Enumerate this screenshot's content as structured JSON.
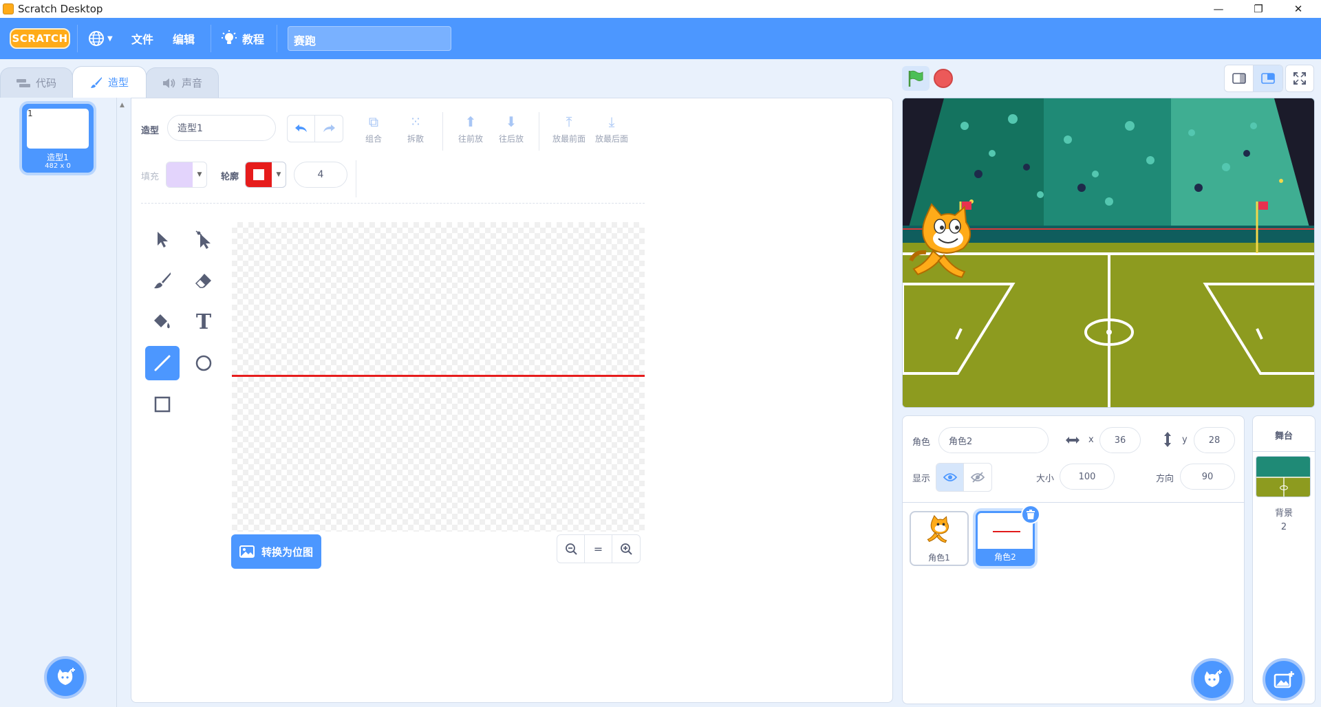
{
  "window": {
    "title": "Scratch Desktop",
    "minimize": "—",
    "restore": "❐",
    "close": "✕"
  },
  "menubar": {
    "logo": "SCRATCH",
    "file": "文件",
    "edit": "编辑",
    "tutorials": "教程",
    "project_title": "赛跑"
  },
  "tabs": {
    "code": "代码",
    "costumes": "造型",
    "sounds": "声音"
  },
  "costume_list": {
    "items": [
      {
        "number": "1",
        "name": "造型1",
        "size": "482 x 0"
      }
    ]
  },
  "paint": {
    "costume_label": "造型",
    "costume_name": "造型1",
    "group": "组合",
    "ungroup": "拆散",
    "forward": "往前放",
    "backward": "往后放",
    "front": "放最前面",
    "back": "放最后面",
    "fill_label": "填充",
    "outline_label": "轮廓",
    "outline_width": "4",
    "fill_color": "#e3d4fc",
    "outline_color": "#e61c1c",
    "convert_bitmap": "转换为位图",
    "zoom_reset": "="
  },
  "sprite_info": {
    "sprite_label": "角色",
    "sprite_name": "角色2",
    "x_label": "x",
    "x_value": "36",
    "y_label": "y",
    "y_value": "28",
    "show_label": "显示",
    "size_label": "大小",
    "size_value": "100",
    "direction_label": "方向",
    "direction_value": "90"
  },
  "sprites": [
    {
      "name": "角色1"
    },
    {
      "name": "角色2"
    }
  ],
  "stage_pane": {
    "title": "舞台",
    "backdrops_label": "背景",
    "backdrops_count": "2"
  },
  "colors": {
    "accent": "#4c97ff",
    "menubar": "#4c97ff",
    "stop": "#ec5959"
  }
}
